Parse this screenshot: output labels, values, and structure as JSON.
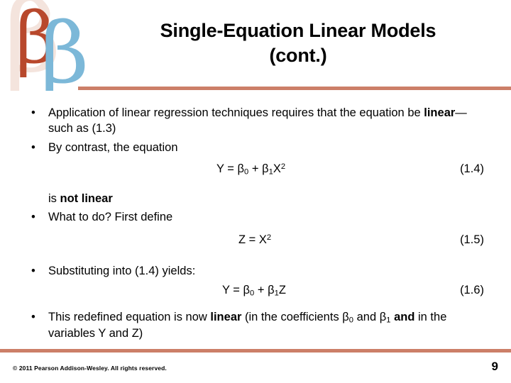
{
  "slide": {
    "title_line1": "Single-Equation Linear Models",
    "title_line2": "(cont.)",
    "accent_color": "#cc7f68",
    "logo": {
      "glyph": "β",
      "pale_color": "#f4e4dd",
      "red_color": "#b8482c",
      "blue_color": "#7cb8d8",
      "name": "beta-logo"
    },
    "bullets": [
      {
        "id": "bullet-1",
        "text_parts": [
          {
            "text": "Application of linear regression techniques requires that the equation be ",
            "bold": false
          },
          {
            "text": "linear",
            "bold": true
          },
          {
            "text": "—such as (1.3)",
            "bold": false
          }
        ],
        "plain": "Application of linear regression techniques requires that the equation be linear—such as (1.3)"
      },
      {
        "id": "bullet-2",
        "text_parts": [
          {
            "text": "By contrast, the equation",
            "bold": false
          }
        ],
        "plain": "By contrast, the equation"
      },
      {
        "id": "bullet-3",
        "text_parts": [
          {
            "text": "What to do? First define",
            "bold": false
          }
        ],
        "plain": "What to do? First define"
      },
      {
        "id": "bullet-4",
        "text_parts": [
          {
            "text": "Substituting into (1.4) yields:",
            "bold": false
          }
        ],
        "plain": "Substituting into (1.4) yields:"
      },
      {
        "id": "bullet-5",
        "text_parts": [
          {
            "text": "This redefined equation is now ",
            "bold": false
          },
          {
            "text": "linear",
            "bold": true
          },
          {
            "text": " (in the coefficients β₀ and β₁ ",
            "bold": false
          },
          {
            "text": "and",
            "bold": true
          },
          {
            "text": " in the variables Y and Z)",
            "bold": false
          }
        ],
        "plain": "This redefined equation is now linear (in the coefficients β₀ and β₁ and in the variables Y and Z)"
      }
    ],
    "interjection": {
      "prefix": "is ",
      "bold": "not linear",
      "plain": "is not linear"
    },
    "equations": [
      {
        "id": "eq-1-4",
        "lhs": "Y",
        "rel": "=",
        "rhs": "β₀ + β₁X²",
        "number": "(1.4)",
        "full": "Y = β₀ + β₁X²"
      },
      {
        "id": "eq-1-5",
        "lhs": "Z",
        "rel": "=",
        "rhs": "X²",
        "number": "(1.5)",
        "full": "Z = X²"
      },
      {
        "id": "eq-1-6",
        "lhs": "Y",
        "rel": "=",
        "rhs": "β₀ + β₁Z",
        "number": "(1.6)",
        "full": "Y = β₀ + β₁Z"
      }
    ],
    "footer": {
      "copyright": "© 2011 Pearson Addison-Wesley. All rights reserved.",
      "page_number": "9"
    },
    "bullet_marker": "•"
  }
}
